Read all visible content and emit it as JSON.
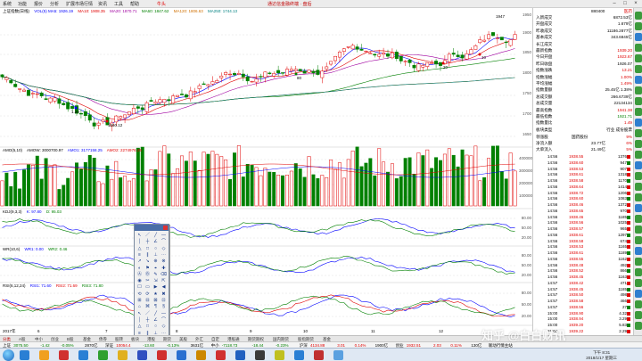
{
  "menubar": {
    "items": [
      "系统",
      "功能",
      "报价",
      "分析",
      "扩展市场行情",
      "资讯",
      "工具",
      "帮助"
    ],
    "user_label": "牛头",
    "title": "通达信金融终端 · 盘后"
  },
  "kline": {
    "legend_name": "上证指数(日线)",
    "legend_items": [
      {
        "text": "VOL(5) MA5: 1926.19",
        "color": "#0000ff"
      },
      {
        "text": "MA10: 1908.35",
        "color": "#e00000"
      },
      {
        "text": "MA20: 1870.71",
        "color": "#a000a0"
      },
      {
        "text": "MA60: 1847.62",
        "color": "#008000"
      },
      {
        "text": "MA120: 1806.63",
        "color": "#d07000"
      },
      {
        "text": "MA250: 1744.13",
        "color": "#008080"
      }
    ],
    "axis": [
      "1950",
      "1900",
      "1850",
      "1800",
      "1750",
      "1700",
      "1650"
    ],
    "annotations": {
      "high": "1947",
      "low": "1560.12",
      "a1": "1.20",
      "a2": "80",
      "a3": "20",
      "a4": "10"
    }
  },
  "volume": {
    "legend_name": "AMO(5,10)",
    "legend_items": [
      {
        "text": "AMOW: 3000700.97",
        "color": "#000000"
      },
      {
        "text": "AMO1: 3177158.25",
        "color": "#0000ff"
      },
      {
        "text": "AMO2: 2274976.25",
        "color": "#e00000"
      }
    ],
    "axis": [
      "400000",
      "300000",
      "200000",
      "100000"
    ]
  },
  "kdj": {
    "legend_name": "KDJ(9,3,3)",
    "legend_items": [
      {
        "text": "K: 97.80",
        "color": "#0000ff"
      },
      {
        "text": "D: 95.03",
        "color": "#008000"
      }
    ],
    "axis": [
      "80.00",
      "50.00",
      "20.00"
    ]
  },
  "wr": {
    "legend_name": "WR(10,6)",
    "legend_items": [
      {
        "text": "WR1: 0.00",
        "color": "#0000ff"
      },
      {
        "text": "WR2: 0.46",
        "color": "#008000"
      }
    ],
    "axis": [
      "80.00",
      "50.00",
      "20.00"
    ]
  },
  "rsi": {
    "legend_name": "RSI(6,12,24)",
    "legend_items": [
      {
        "text": "RSI1: 71.60",
        "color": "#0000ff"
      },
      {
        "text": "RSI2: 71.69",
        "color": "#e00000"
      },
      {
        "text": "RSI3: 71.80",
        "color": "#008000"
      }
    ],
    "axis": [
      "80.00",
      "50.00",
      "20.00"
    ]
  },
  "date_axis": [
    "2017年",
    "6",
    "7",
    "8",
    "9",
    "10",
    "11",
    "12"
  ],
  "info": {
    "code": "880400",
    "name": "医药",
    "rows": [
      {
        "lbl": "入新成交",
        "val": "6872.53亿",
        "cls": "neu"
      },
      {
        "lbl": "开盘成交",
        "val": "1.679亿",
        "cls": "neu"
      },
      {
        "lbl": "昨收成交",
        "val": "11186.2877亿",
        "cls": "neu"
      },
      {
        "lbl": "基本成交",
        "val": "343.6845亿",
        "cls": "neu"
      },
      {
        "lbl": "长江成交",
        "val": "",
        "cls": "neu"
      },
      {
        "lbl": "最新指数",
        "val": "1939.20",
        "cls": "up"
      },
      {
        "lbl": "今日开盘",
        "val": "1923.67",
        "cls": "up"
      },
      {
        "lbl": "昨日收盘",
        "val": "1926.07",
        "cls": "neu"
      },
      {
        "lbl": "指数涨跌",
        "val": "13.21",
        "cls": "up"
      },
      {
        "lbl": "指数涨幅",
        "val": "1.00%",
        "cls": "up"
      },
      {
        "lbl": "平均涨幅",
        "val": "1.49%",
        "cls": "up"
      },
      {
        "lbl": "指数量额",
        "val": "25.45亿 1.38%",
        "cls": "neu"
      },
      {
        "lbl": "总成交额",
        "val": "266.6739亿",
        "cls": "neu"
      },
      {
        "lbl": "总成交量",
        "val": "22134134",
        "cls": "neu"
      },
      {
        "lbl": "最高指数",
        "val": "1941.38",
        "cls": "up"
      },
      {
        "lbl": "最低指数",
        "val": "1921.71",
        "cls": "down"
      },
      {
        "lbl": "指数量比",
        "val": "1.49",
        "cls": "up"
      },
      {
        "lbl": "板块类型",
        "val": "行业 成份股票",
        "cls": "neu"
      }
    ],
    "leader": {
      "lbl": "领涨股",
      "name": "国药股份",
      "val": "9%"
    },
    "flow": [
      {
        "lbl": "净流入额",
        "val": "23.77亿",
        "pct": "6%"
      },
      {
        "lbl": "大单流入",
        "val": "21.49亿",
        "pct": "5%"
      }
    ],
    "ticks": [
      {
        "t": "14:56",
        "p": "1938.55",
        "v": "1376"
      },
      {
        "t": "14:56",
        "p": "1938.60",
        "v": "947"
      },
      {
        "t": "14:56",
        "p": "1938.53",
        "v": "907"
      },
      {
        "t": "14:56",
        "p": "1938.61",
        "v": "1318"
      },
      {
        "t": "14:56",
        "p": "1938.58",
        "v": "1170"
      },
      {
        "t": "14:56",
        "p": "1938.64",
        "v": "1414"
      },
      {
        "t": "14:56",
        "p": "1938.72",
        "v": "1206"
      },
      {
        "t": "14:56",
        "p": "1938.60",
        "v": "1083"
      },
      {
        "t": "14:56",
        "p": "1938.46",
        "v": "1372"
      },
      {
        "t": "14:56",
        "p": "1938.65",
        "v": "970"
      },
      {
        "t": "14:56",
        "p": "1938.46",
        "v": "1185"
      },
      {
        "t": "14:56",
        "p": "1938.56",
        "v": "1025"
      },
      {
        "t": "14:56",
        "p": "1938.57",
        "v": "965"
      },
      {
        "t": "14:56",
        "p": "1938.61",
        "v": "1297"
      },
      {
        "t": "14:56",
        "p": "1938.58",
        "v": "674"
      },
      {
        "t": "14:56",
        "p": "1938.53",
        "v": "1165"
      },
      {
        "t": "14:56",
        "p": "1938.61",
        "v": "1189"
      },
      {
        "t": "14:56",
        "p": "1938.55",
        "v": "1162"
      },
      {
        "t": "14:56",
        "p": "1938.48",
        "v": "492"
      },
      {
        "t": "14:56",
        "p": "1938.52",
        "v": "866"
      },
      {
        "t": "14:56",
        "p": "1938.45",
        "v": "1163"
      },
      {
        "t": "14:57",
        "p": "1938.42",
        "v": "471"
      },
      {
        "t": "14:57",
        "p": "1938.45",
        "v": "1185"
      },
      {
        "t": "14:57",
        "p": "1938.50",
        "v": "498"
      },
      {
        "t": "14:57",
        "p": "1938.58",
        "v": "466"
      },
      {
        "t": "14:57",
        "p": "1938.56",
        "v": "27"
      },
      {
        "t": "15:00",
        "p": "1938.90",
        "v": "4.32"
      },
      {
        "t": "15:00",
        "p": "1938.94",
        "v": "3.29"
      },
      {
        "t": "15:00",
        "p": "1939.20",
        "v": "5.83"
      },
      {
        "t": "15:00",
        "p": "1939.22",
        "v": "2.29"
      }
    ]
  },
  "tabs": [
    "分类",
    "A股",
    "中小",
    "创业",
    "B股",
    "基金",
    "债券",
    "股转",
    "板块",
    "港股",
    "期货",
    "美股",
    "外汇",
    "自定",
    "港股通",
    "期货期权",
    "国内期货",
    "股指期货",
    "基金"
  ],
  "status": [
    {
      "text": "上证",
      "color": "#000000"
    },
    {
      "text": "3075.50",
      "color": "#008000"
    },
    {
      "text": "-1.42",
      "color": "#008000"
    },
    {
      "text": "-0.05%",
      "color": "#008000"
    },
    {
      "text": "2870亿",
      "color": "#000000"
    },
    {
      "text": "深证",
      "color": "#000000"
    },
    {
      "text": "10054.4",
      "color": "#e00000"
    },
    {
      "text": "-13.60",
      "color": "#008000"
    },
    {
      "text": "-0.13%",
      "color": "#008000"
    },
    {
      "text": "3631亿",
      "color": "#000000"
    },
    {
      "text": "中小",
      "color": "#000000"
    },
    {
      "text": "-7118.73",
      "color": "#008000"
    },
    {
      "text": "-18.44",
      "color": "#008000"
    },
    {
      "text": "-0.23%",
      "color": "#008000"
    },
    {
      "text": "沪深",
      "color": "#000000"
    },
    {
      "text": "4134.88",
      "color": "#e00000"
    },
    {
      "text": "3.01",
      "color": "#e00000"
    },
    {
      "text": "0.14%",
      "color": "#e00000"
    },
    {
      "text": "1900亿",
      "color": "#000000"
    },
    {
      "text": "创业",
      "color": "#000000"
    },
    {
      "text": "1932.51",
      "color": "#e00000"
    },
    {
      "text": "2.03",
      "color": "#e00000"
    },
    {
      "text": "0.11%",
      "color": "#e00000"
    },
    {
      "text": "130亿",
      "color": "#000000"
    },
    {
      "text": "联动行情主站",
      "color": "#000000"
    }
  ],
  "taskbar": {
    "time": "下午 8:31",
    "date": "2018/1/17 星期三"
  },
  "watermark": "知乎 @白白财讯",
  "colors": {
    "up": "#e00000",
    "down": "#008000",
    "ma_blue": "#0000ff"
  }
}
